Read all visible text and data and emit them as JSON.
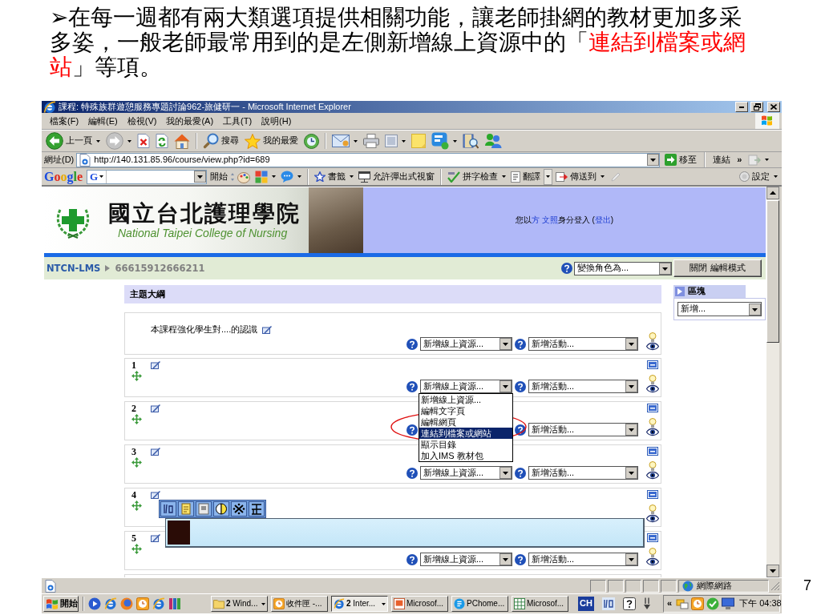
{
  "slide": {
    "paragraph": [
      {
        "text": "➢在每一週都有兩大類選項提供相關功能，讓老師掛網的教材更加多采多姿，一般老師最常用到的是左側新增線上資源中的「",
        "highlight": false
      },
      {
        "text": "連結到檔案或網站",
        "highlight": true
      },
      {
        "text": "」等項。",
        "highlight": false
      }
    ],
    "page_number": "7"
  },
  "window": {
    "title": "課程: 特殊族群遊憩服務專題討論962-旅健研一 - Microsoft Internet Explorer",
    "menu": [
      "檔案(F)",
      "編輯(E)",
      "檢視(V)",
      "我的最愛(A)",
      "工具(T)",
      "說明(H)"
    ],
    "toolbar": {
      "back": {
        "label": "上一頁"
      },
      "forward": {
        "disabled": true
      },
      "search": {
        "label": "搜尋"
      },
      "favorites": {
        "label": "我的最愛"
      }
    },
    "address_bar": {
      "label": "網址(D)",
      "url": "http://140.131.85.96/course/view.php?id=689",
      "go": "移至",
      "links": "連結",
      "links_more": "»"
    },
    "google_bar": {
      "logo": "Google",
      "engine_button": "G",
      "search_button": "開始",
      "bookmarks": "書籤",
      "popup_blocker": "允許彈出式視窗",
      "spellcheck": "拼字檢查",
      "translate": "翻譯",
      "send_to": "傳送到",
      "settings": "設定"
    }
  },
  "page": {
    "header": {
      "college_name": "國立台北護理學院",
      "college_name_en": "National Taipei College of Nursing",
      "login": [
        {
          "text": "您以",
          "link": false
        },
        {
          "text": "方 文照",
          "link": true
        },
        {
          "text": "身分登入 (",
          "link": false
        },
        {
          "text": "登出",
          "link": true
        },
        {
          "text": ")",
          "link": false
        }
      ]
    },
    "breadcrumb": [
      "NTCN-LMS",
      "66615912666211"
    ],
    "role_select": "變換角色為...",
    "edit_mode_button": "關閉 編輯模式",
    "outline_title": "主題大綱",
    "sections": [
      {
        "summary": "本課程強化學生對....的認識",
        "resource_select": "新增線上資源...",
        "activity_select": "新增活動..."
      },
      {
        "number": "1",
        "resource_select": "新增線上資源...",
        "activity_select": "新增活動...",
        "open_menu": [
          {
            "text": "新增線上資源...",
            "selected": false,
            "circled": false
          },
          {
            "text": "編輯文字頁",
            "selected": false,
            "circled": false
          },
          {
            "text": "編輯網頁",
            "selected": false,
            "circled": false
          },
          {
            "text": "連結到檔案或網站",
            "selected": true,
            "circled": true
          },
          {
            "text": "顯示目錄",
            "selected": false,
            "circled": false
          },
          {
            "text": "加入IMS 教材包",
            "selected": false,
            "circled": false
          }
        ]
      },
      {
        "number": "2",
        "activity_select": "新增活動..."
      },
      {
        "number": "3",
        "resource_select": "新增線上資源...",
        "activity_select": "新增活動..."
      },
      {
        "number": "4"
      },
      {
        "number": "5",
        "resource_select": "新增線上資源...",
        "activity_select": "新增活動..."
      }
    ],
    "blocks": {
      "title": "區塊",
      "add_select": "新增..."
    }
  },
  "status_bar": {
    "zone": "網際網路"
  },
  "taskbar": {
    "start": "開始",
    "tasks": [
      {
        "label": "**2** Wind...",
        "dropdown": true,
        "selected": false
      },
      {
        "label": "收件匣 -...",
        "dropdown": false,
        "selected": false
      },
      {
        "label": "**2** Inter...",
        "dropdown": true,
        "selected": true
      },
      {
        "label": "Microsof...",
        "dropdown": false,
        "selected": false
      },
      {
        "label": "PChome...",
        "dropdown": false,
        "selected": false
      },
      {
        "label": "Microsof...",
        "dropdown": false,
        "selected": false
      }
    ],
    "language": "CH",
    "tray_expand": "«",
    "clock": "下午 04:38"
  }
}
